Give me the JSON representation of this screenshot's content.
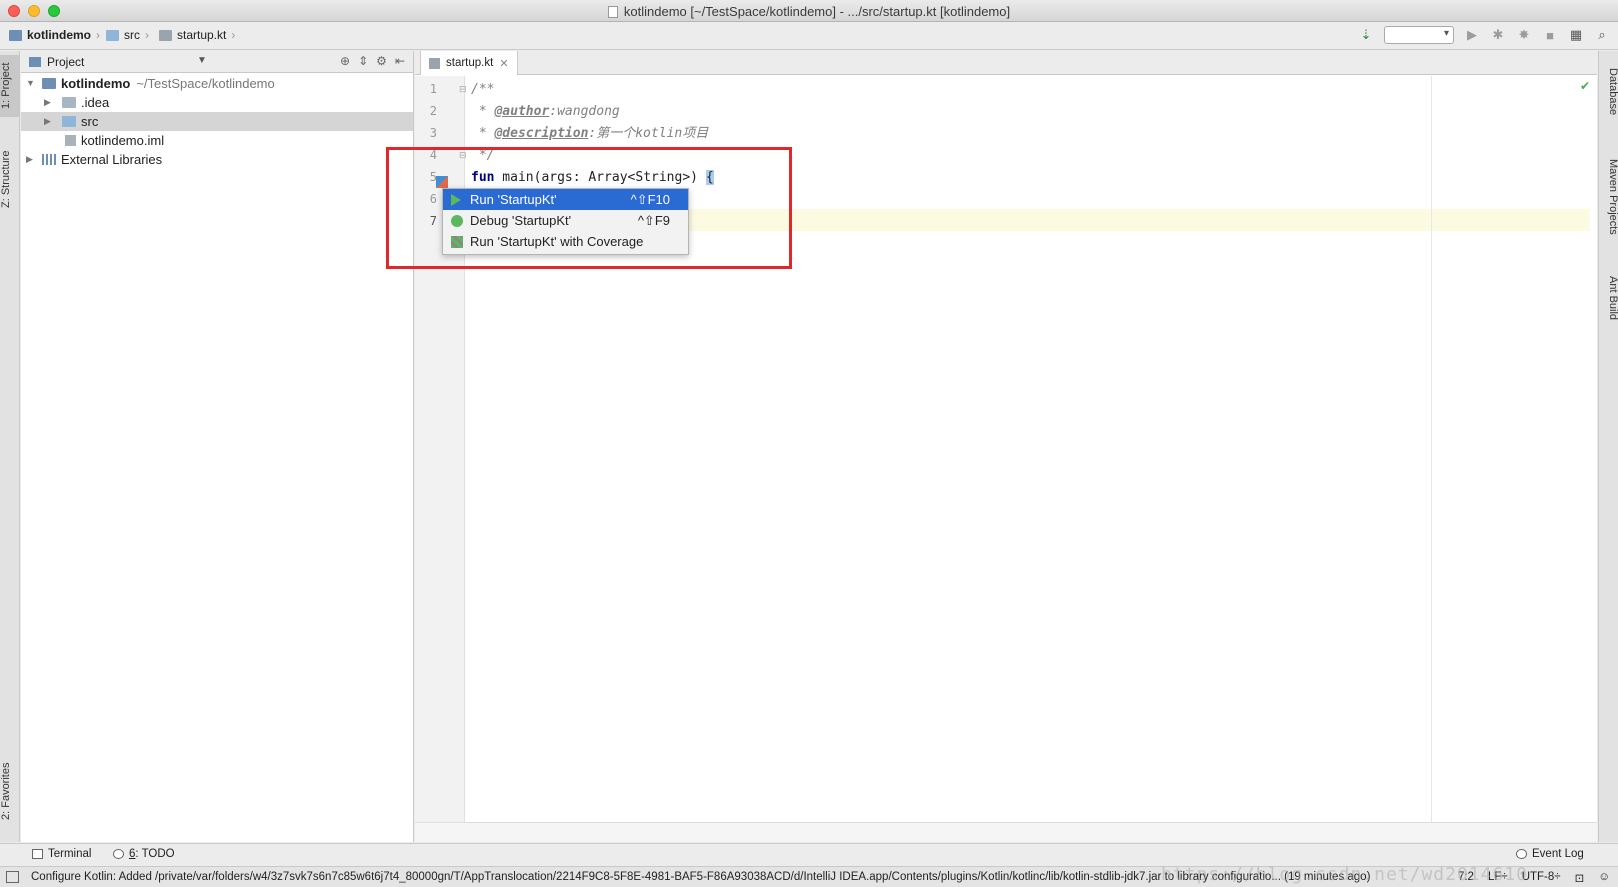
{
  "window": {
    "title": "kotlindemo [~/TestSpace/kotlindemo] - .../src/startup.kt [kotlindemo]"
  },
  "breadcrumb": {
    "items": [
      {
        "label": "kotlindemo",
        "icon": "module-icon"
      },
      {
        "label": "src",
        "icon": "folder-icon"
      },
      {
        "label": "startup.kt",
        "icon": "kotlin-file-icon"
      }
    ]
  },
  "left_strip": {
    "project_tab": "1: Project",
    "structure_tab": "Z: Structure",
    "favorites_tab": "2: Favorites"
  },
  "right_strip": {
    "database_tab": "Database",
    "maven_tab": "Maven Projects",
    "ant_tab": "Ant Build"
  },
  "project_panel": {
    "header_label": "Project",
    "tree": [
      {
        "label": "kotlindemo",
        "sub": "~/TestSpace/kotlindemo"
      },
      {
        "label": ".idea"
      },
      {
        "label": "src"
      },
      {
        "label": "kotlindemo.iml"
      },
      {
        "label": "External Libraries"
      }
    ]
  },
  "editor": {
    "tab_label": "startup.kt",
    "line_numbers": [
      "1",
      "2",
      "3",
      "4",
      "5",
      "6",
      "7"
    ],
    "code": {
      "l1": "/**",
      "l2_prefix": " * ",
      "l2_tag": "@author",
      "l2_text": ":wangdong",
      "l3_prefix": " * ",
      "l3_tag": "@description",
      "l3_text": ":第一个kotlin项目",
      "l4": " */",
      "l5_kw": "fun",
      "l5_text": " main(args: Array<String>) ",
      "l5_brace": "{"
    }
  },
  "run_popup": {
    "items": [
      {
        "label": "Run 'StartupKt'",
        "shortcut": "^⇧F10",
        "icon": "run-icon"
      },
      {
        "label": "Debug 'StartupKt'",
        "shortcut": "^⇧F9",
        "icon": "debug-icon"
      },
      {
        "label": "Run 'StartupKt' with Coverage",
        "shortcut": "",
        "icon": "coverage-icon"
      }
    ]
  },
  "bottom_tools": {
    "terminal": "Terminal",
    "todo_num": "6",
    "todo_label": ": TODO",
    "event_log": "Event Log"
  },
  "status": {
    "message": "Configure Kotlin: Added /private/var/folders/w4/3z7svk7s6n7c85w6t6j7t4_80000gn/T/AppTranslocation/2214F9C8-5F8E-4981-BAF5-F86A93038ACD/d/IntelliJ IDEA.app/Contents/plugins/Kotlin/kotlinc/lib/kotlin-stdlib-jdk7.jar to library configuratio... (19 minutes ago)",
    "position": "7:2",
    "line_sep": "LF÷",
    "encoding": "UTF-8÷"
  },
  "watermark": "https://blog.csdn.net/wd2014610"
}
